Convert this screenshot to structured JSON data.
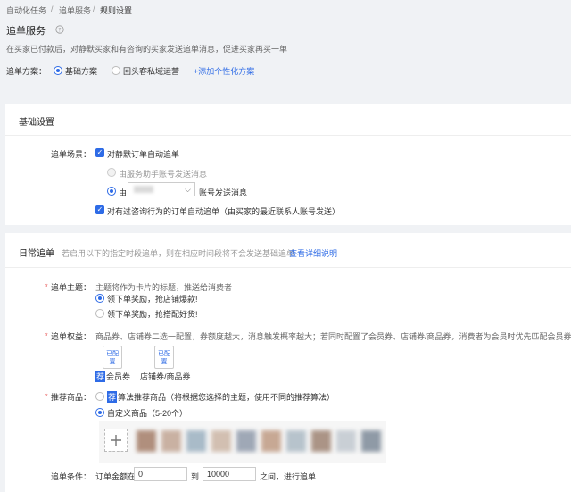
{
  "breadcrumb": {
    "items": [
      "自动化任务",
      "追单服务",
      "规则设置"
    ],
    "sep": "/"
  },
  "header": {
    "title": "追单服务",
    "help_icon": "question-circle-icon",
    "desc": "在买家已付款后，对静默买家和有咨询的买家发送追单消息，促进买家再买一单"
  },
  "plan": {
    "label": "追单方案：",
    "options": [
      "基础方案",
      "回头客私域运营"
    ],
    "selected": 0,
    "add_link": "+添加个性化方案"
  },
  "basic": {
    "title": "基础设置",
    "scene_label": "追单场景：",
    "silent": "对静默订单自动追单",
    "sub_a": "由服务助手账号发送消息",
    "sub_b_prefix": "由",
    "sub_b_suffix": "账号发送消息",
    "consult": "对有过咨询行为的订单自动追单（由买家的最近联系人账号发送）"
  },
  "daily": {
    "title": "日常追单",
    "hint": "若启用以下的指定时段追单，则在相应时间段将不会发送基础追单",
    "detail_link": "查看详细说明",
    "theme": {
      "label": "追单主题：",
      "desc": "主题将作为卡片的标题，推送给消费者",
      "options": [
        "领下单奖励，抢店铺爆款!",
        "领下单奖励，抢搭配好货!"
      ],
      "selected": 0
    },
    "rights": {
      "label": "追单权益：",
      "desc": "商品券、店铺券二选一配置，券额度越大，消息触发概率越大；若同时配置了会员券、店铺券/商品券，消费者为会员时优先匹配会员券",
      "coupon_text": "已配置",
      "badge": "荐",
      "member_label": "会员券",
      "shop_label": "店铺券/商品券"
    },
    "rec": {
      "label": "推荐商品：",
      "badge": "荐",
      "algo": "算法推荐商品（将根据您选择的主题，使用不同的推荐算法）",
      "custom": "自定义商品（5-20个）",
      "selected": 1,
      "add_icon": "plus-icon"
    },
    "cond": {
      "label": "追单条件：",
      "prefix": "订单金额在",
      "min": "0",
      "mid": "到",
      "max": "10000",
      "suffix": "之间，进行追单"
    },
    "required_mark": "*"
  }
}
